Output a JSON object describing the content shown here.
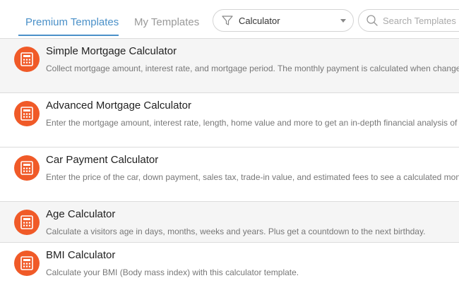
{
  "tabs": [
    {
      "label": "Premium Templates",
      "active": true
    },
    {
      "label": "My Templates",
      "active": false
    }
  ],
  "filter": {
    "value": "Calculator",
    "icon": "funnel-icon"
  },
  "search": {
    "placeholder": "Search Templates",
    "value": "",
    "icon": "search-icon"
  },
  "colors": {
    "accent": "#4a90c8",
    "icon_bg": "#f05a28"
  },
  "templates": [
    {
      "title": "Simple Mortgage Calculator",
      "description": "Collect mortgage amount, interest rate, and mortgage period. The monthly payment is calculated when changes are made.",
      "icon": "calculator-icon"
    },
    {
      "title": "Advanced Mortgage Calculator",
      "description": "Enter the mortgage amount, interest rate, length, home value and more to get an in-depth financial analysis of your mortgage.",
      "icon": "calculator-icon"
    },
    {
      "title": "Car Payment Calculator",
      "description": "Enter the price of the car, down payment, sales tax, trade-in value, and estimated fees to see a calculated monthly payment.",
      "icon": "calculator-icon"
    },
    {
      "title": "Age Calculator",
      "description": "Calculate a visitors age in days, months, weeks and years. Plus get a countdown to the next birthday.",
      "icon": "calculator-icon"
    },
    {
      "title": "BMI Calculator",
      "description": "Calculate your BMI (Body mass index) with this calculator template.",
      "icon": "calculator-icon"
    }
  ]
}
